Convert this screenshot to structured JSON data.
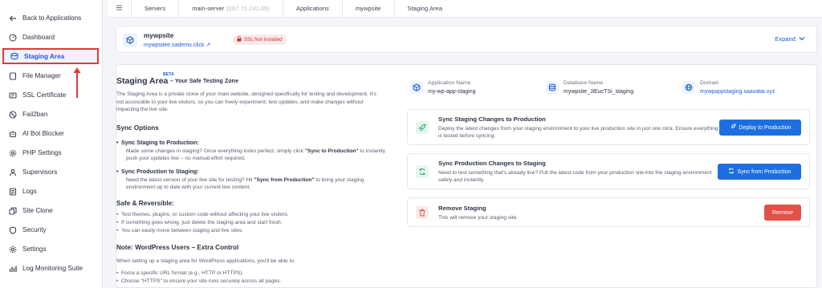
{
  "sidebar": {
    "items": [
      {
        "label": "Back to Applications",
        "icon": "arrow-left-icon"
      },
      {
        "label": "Dashboard",
        "icon": "dashboard-icon"
      },
      {
        "label": "Staging Area",
        "icon": "staging-icon",
        "active": true
      },
      {
        "label": "File Manager",
        "icon": "file-icon"
      },
      {
        "label": "SSL Certificate",
        "icon": "certificate-icon"
      },
      {
        "label": "Fail2ban",
        "icon": "ban-icon"
      },
      {
        "label": "AI Bot Blocker",
        "icon": "bot-icon"
      },
      {
        "label": "PHP Settings",
        "icon": "gear-icon"
      },
      {
        "label": "Supervisors",
        "icon": "supervisor-icon"
      },
      {
        "label": "Logs",
        "icon": "logs-icon"
      },
      {
        "label": "Site Clone",
        "icon": "clone-icon"
      },
      {
        "label": "Security",
        "icon": "shield-icon"
      },
      {
        "label": "Settings",
        "icon": "gear-icon"
      },
      {
        "label": "Log Monitoring Suite",
        "icon": "chart-icon"
      }
    ]
  },
  "breadcrumb": {
    "servers": "Servers",
    "server": "main-server",
    "server_ip": "(167.71.241.05)",
    "applications": "Applications",
    "site": "mywpsite",
    "current": "Staging Area"
  },
  "site": {
    "name": "mywpsite",
    "url": "mywpsitee.sademo.click ↗",
    "ssl_status": "SSL Not Installed",
    "expand_label": "Expand"
  },
  "intro": {
    "title": "Staging Area",
    "beta": "BETA",
    "subtitle": "– Your Safe Testing Zone",
    "paragraph": "The Staging Area is a private clone of your main website, designed specifically for testing and development. It's not accessible to your live visitors, so you can freely experiment, test updates, and make changes without impacting the live site.",
    "sync_heading": "Sync Options",
    "sync1_title": "Sync Staging to Production:",
    "sync1_a": "Made some changes in staging? Once everything looks perfect, simply click ",
    "sync1_b": "\"Sync to Production\"",
    "sync1_c": " to instantly push your updates live – no manual effort required.",
    "sync2_title": "Sync Production to Staging:",
    "sync2_a": "Need the latest version of your live site for testing? Hit ",
    "sync2_b": "\"Sync from Production\"",
    "sync2_c": " to bring your staging environment up to date with your current live content.",
    "safe_heading": "Safe & Reversible:",
    "safe_items": [
      "Test themes, plugins, or custom code without affecting your live visitors.",
      "If something goes wrong, just delete the staging area and start fresh.",
      "You can easily move between staging and live sites."
    ],
    "note_heading": "Note: WordPress Users – Extra Control",
    "note_text": "When setting up a staging area for WordPress applications, you'll be able to:",
    "note_items": [
      "Force a specific URL format (e.g., HTTP or HTTPS).",
      "Choose \"HTTPS\" to ensure your site runs securely across all pages."
    ]
  },
  "info": {
    "app_label": "Application Name",
    "app_value": "my-wp-app-staging",
    "db_label": "Database Name",
    "db_value": "mywpsite_JiEucTSi_staging",
    "domain_label": "Domain",
    "domain_value": "mywpappstaging.saavatar.xyz"
  },
  "actions": {
    "deploy": {
      "title": "Sync Staging Changes to Production",
      "desc": "Deploy the latest changes from your staging environment to your live production site in just one click. Ensure everything is tested before syncing.",
      "button": "Deploy to Production"
    },
    "sync": {
      "title": "Sync Production Changes to Staging",
      "desc": "Need to test something that's already live? Pull the latest code from your production site into the staging environment safely and instantly.",
      "button": "Sync from Production"
    },
    "remove": {
      "title": "Remove Staging",
      "desc": "This will remove your staging site.",
      "button": "Remove"
    }
  },
  "colors": {
    "accent": "#1d6fe0",
    "danger": "#e25148",
    "annotation": "#e53935",
    "success": "#2fa36b"
  }
}
